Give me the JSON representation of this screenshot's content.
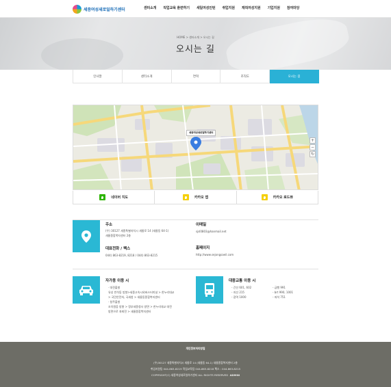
{
  "header": {
    "logo_text": "세종여성새로일하기센터",
    "nav": [
      "센터소개",
      "직업교육 훈련하기",
      "새일여성인턴",
      "취업지원",
      "재직여성지원",
      "기업지원",
      "참여마당"
    ]
  },
  "visual": {
    "breadcrumb": "HOME > 센터소개 > 오시는 길",
    "title": "오시는 길"
  },
  "tabs": [
    {
      "label": "인사말",
      "active": false
    },
    {
      "label": "센터소개",
      "active": false
    },
    {
      "label": "연혁",
      "active": false
    },
    {
      "label": "조직도",
      "active": false
    },
    {
      "label": "오시는 길",
      "active": true
    }
  ],
  "map": {
    "pin_label": "세종여성새로일하기센터",
    "zoom_in": "+",
    "zoom_out": "−",
    "reset": "↻"
  },
  "map_links": [
    {
      "label": "네이버 지도",
      "color": "#2db400"
    },
    {
      "label": "카카오 맵",
      "color": "#f5d00d"
    },
    {
      "label": "카카오 로드뷰",
      "color": "#f5d00d"
    }
  ],
  "contact": {
    "address_title": "주소",
    "address_line1": "(우) 30127 세종특별자치시 새롬로 14 (새롬동 64-1)",
    "address_line2": "새롬종합복지센터 2층",
    "phone_title": "대표전화 / 팩스",
    "phone_text": "044) 863-8219, 8218 / 044) 863-8215",
    "email_title": "이메일",
    "email_text": "sjsl0803@hanmail.net",
    "homepage_title": "홈페이지",
    "homepage_text": "http://www.sejongsaeil.com"
  },
  "car": {
    "title": "자가용 이용 시",
    "lines": [
      "· 대전출발",
      "유성 반석동 방향>세종고속시외버스터미널 > 한누리대교",
      "> 국민안전처, 국세청 > 새롬동종합복지센터",
      "· 청주출발",
      "조치원읍 방향 > 정부세종청사 방면 > 한누리대교 대전",
      "방면으로 좌회전 > 새롬종합복지센터"
    ]
  },
  "bus": {
    "title": "대중교통 이용 시",
    "col1": [
      "- 간선 601, 602",
      "- 지선 215",
      "- 광역 1000"
    ],
    "col2": [
      "- 급행 991",
      "- brt 990, 1001",
      "- 좌석 751"
    ]
  },
  "footer": {
    "policy": "개인정보처리방침",
    "address": "(우)30127 세종특별자치시 새롬로 14 (새롬동 64-1) 새롬종합복지센터 2층",
    "phones": "취업지원팀 044-863-8219    직업교육팀 044-863-8218    팩스 : 044-863-8215",
    "copyright": "COPYRIGHT(C) 세종여성새로일하기센터 ALL RIGHTS RESERVED",
    "admin": "ADMIN"
  },
  "colors": {
    "accent": "#2ab8d4",
    "footer_bg": "#6d6d66",
    "naver": "#2db400",
    "kakao": "#f5d00d"
  }
}
